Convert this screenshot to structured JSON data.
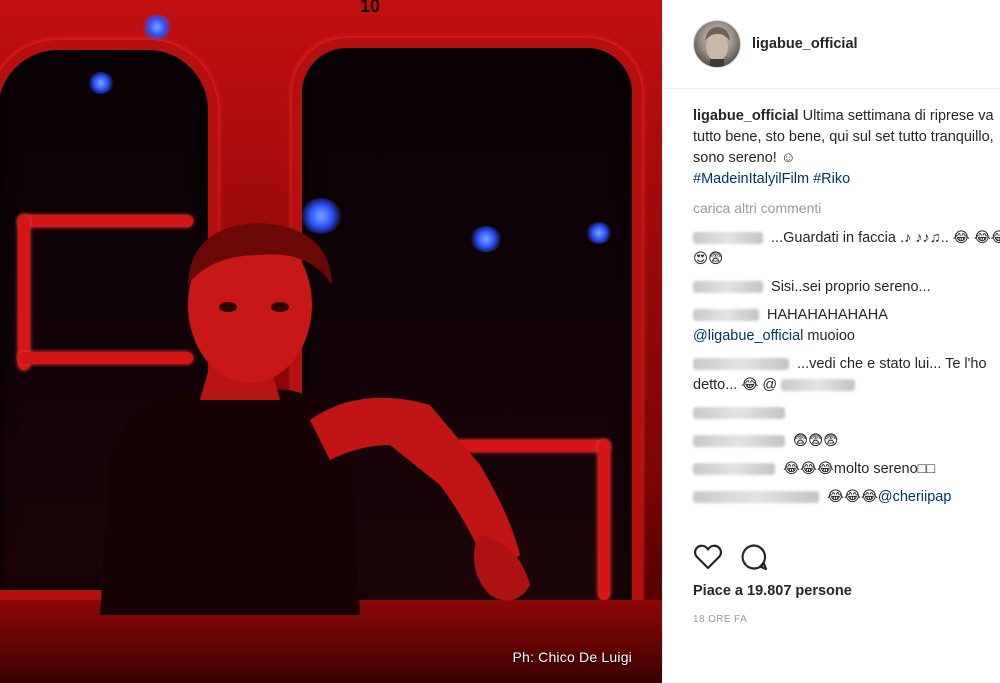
{
  "photo": {
    "credit": "Ph: Chico De Luigi",
    "car_number": "10"
  },
  "post": {
    "username": "ligabue_official",
    "caption_user": "ligabue_official",
    "caption_text": "Ultima settimana di riprese va tutto bene, sto bene, qui sul set tutto tranquillo, sono sereno! ☺",
    "hashtag1": "#MadeinItalyilFilm",
    "hashtag2": "#Riko",
    "load_more": "carica altri commenti"
  },
  "comments": [
    {
      "text": "...Guardati in faccia .♪ ♪♪♫.. 😂 😂😂😍😨"
    },
    {
      "text": "Sisi..sei proprio sereno..."
    },
    {
      "text": "HAHAHAHAHAHA",
      "mention": "@ligabue_official",
      "after": " muoioo"
    },
    {
      "text": "...vedi che e stato lui... Te l'ho detto... 😂 @"
    },
    {
      "text": ""
    },
    {
      "text": "😨😨😨"
    },
    {
      "text": "😂😂😂molto sereno□□"
    },
    {
      "text": "😂😂😂",
      "mention": "@cheriipap"
    }
  ],
  "likes": {
    "label_prefix": "Piace a",
    "count": "19.807",
    "label_suffix": "persone"
  },
  "timestamp": "18 ORE FA",
  "icons": {
    "like": "heart-icon",
    "comment": "comment-bubble-icon"
  },
  "colors": {
    "accent": "#003569",
    "muted": "#999999",
    "photo_red": "#c21010"
  }
}
